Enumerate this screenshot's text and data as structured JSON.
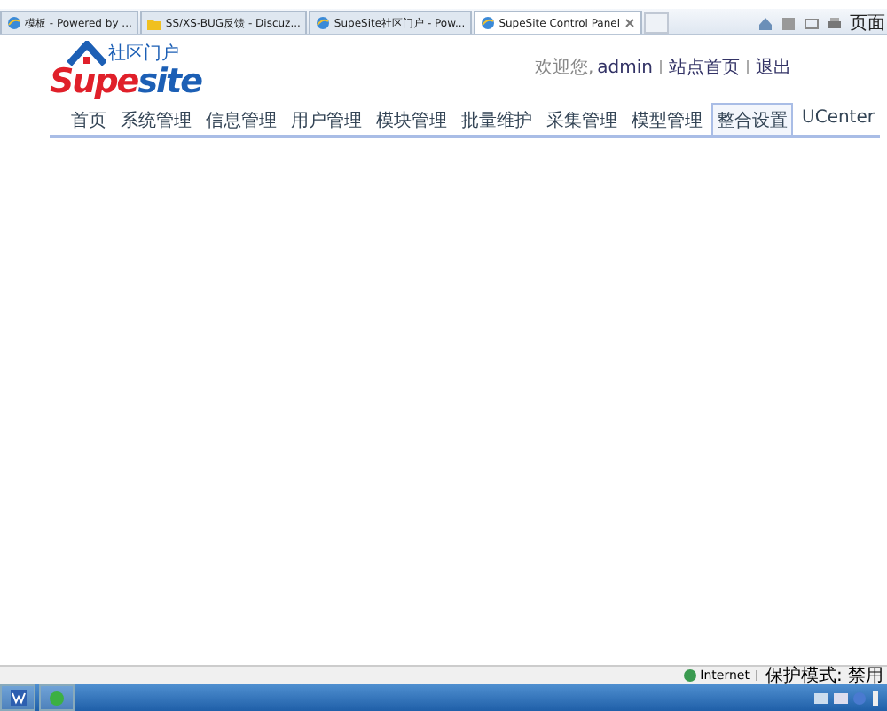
{
  "browser_tabs": [
    {
      "label": "模板 - Powered by ...",
      "selected": false,
      "kind": "page"
    },
    {
      "label": "SS/XS-BUG反馈 - Discuz...",
      "selected": false,
      "kind": "forum"
    },
    {
      "label": "SupeSite社区门户 - Pow...",
      "selected": false,
      "kind": "page"
    },
    {
      "label": "SupeSite Control Panel",
      "selected": true,
      "kind": "page"
    }
  ],
  "toolbar": {
    "menu_label": "页面"
  },
  "logo": {
    "tagline": "社区门户",
    "name_part1": "Supe",
    "name_part2": "site"
  },
  "user_bar": {
    "greeting": "欢迎您,",
    "user": "admin",
    "links": [
      "站点首页",
      "退出"
    ]
  },
  "nav": [
    {
      "label": "首页",
      "selected": false
    },
    {
      "label": "系统管理",
      "selected": false
    },
    {
      "label": "信息管理",
      "selected": false
    },
    {
      "label": "用户管理",
      "selected": false
    },
    {
      "label": "模块管理",
      "selected": false
    },
    {
      "label": "批量维护",
      "selected": false
    },
    {
      "label": "采集管理",
      "selected": false
    },
    {
      "label": "模型管理",
      "selected": false
    },
    {
      "label": "整合设置",
      "selected": true
    },
    {
      "label": "UCenter",
      "selected": false
    }
  ],
  "status_bar": {
    "zone": "Internet",
    "mode": "保护模式: 禁用"
  }
}
